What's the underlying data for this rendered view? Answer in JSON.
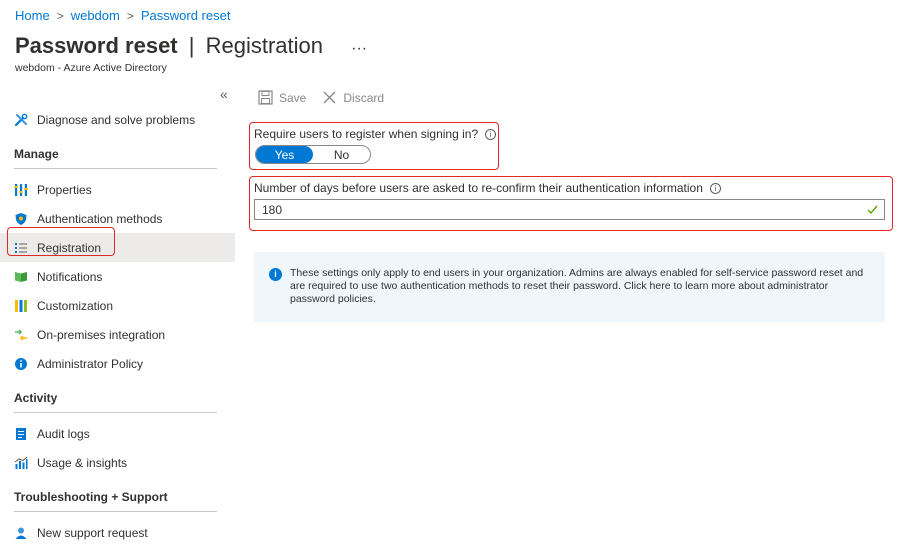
{
  "breadcrumb": {
    "home": "Home",
    "tenant": "webdom",
    "current": "Password reset",
    "separator": ">"
  },
  "header": {
    "title_main": "Password reset",
    "title_sep": "|",
    "title_sub": "Registration",
    "more": "···",
    "subtitle": "webdom - Azure Active Directory"
  },
  "sidebar": {
    "collapse": "«",
    "top_items": [
      {
        "label": "Diagnose and solve problems",
        "icon": "wrench-icon"
      }
    ],
    "sections": [
      {
        "title": "Manage",
        "items": [
          {
            "label": "Properties",
            "icon": "properties-icon"
          },
          {
            "label": "Authentication methods",
            "icon": "shield-icon"
          },
          {
            "label": "Registration",
            "icon": "registration-icon",
            "active": true
          },
          {
            "label": "Notifications",
            "icon": "notifications-icon"
          },
          {
            "label": "Customization",
            "icon": "customization-icon"
          },
          {
            "label": "On-premises integration",
            "icon": "onprem-icon"
          },
          {
            "label": "Administrator Policy",
            "icon": "info-icon"
          }
        ]
      },
      {
        "title": "Activity",
        "items": [
          {
            "label": "Audit logs",
            "icon": "audit-icon"
          },
          {
            "label": "Usage & insights",
            "icon": "chart-icon"
          }
        ]
      },
      {
        "title": "Troubleshooting + Support",
        "items": [
          {
            "label": "New support request",
            "icon": "support-icon"
          }
        ]
      }
    ]
  },
  "toolbar": {
    "save_label": "Save",
    "discard_label": "Discard"
  },
  "form": {
    "require_register_label": "Require users to register when signing in?",
    "toggle": {
      "yes": "Yes",
      "no": "No",
      "selected": "Yes"
    },
    "days_label": "Number of days before users are asked to re-confirm their authentication information",
    "days_value": "180"
  },
  "banner": {
    "text": "These settings only apply to end users in your organization. Admins are always enabled for self-service password reset and are required to use two authentication methods to reset their password. Click here to learn more about administrator password policies."
  },
  "colors": {
    "accent": "#0078d4",
    "highlight": "#e02828",
    "banner_bg": "#eff6fc",
    "active_nav": "#edebe9"
  }
}
